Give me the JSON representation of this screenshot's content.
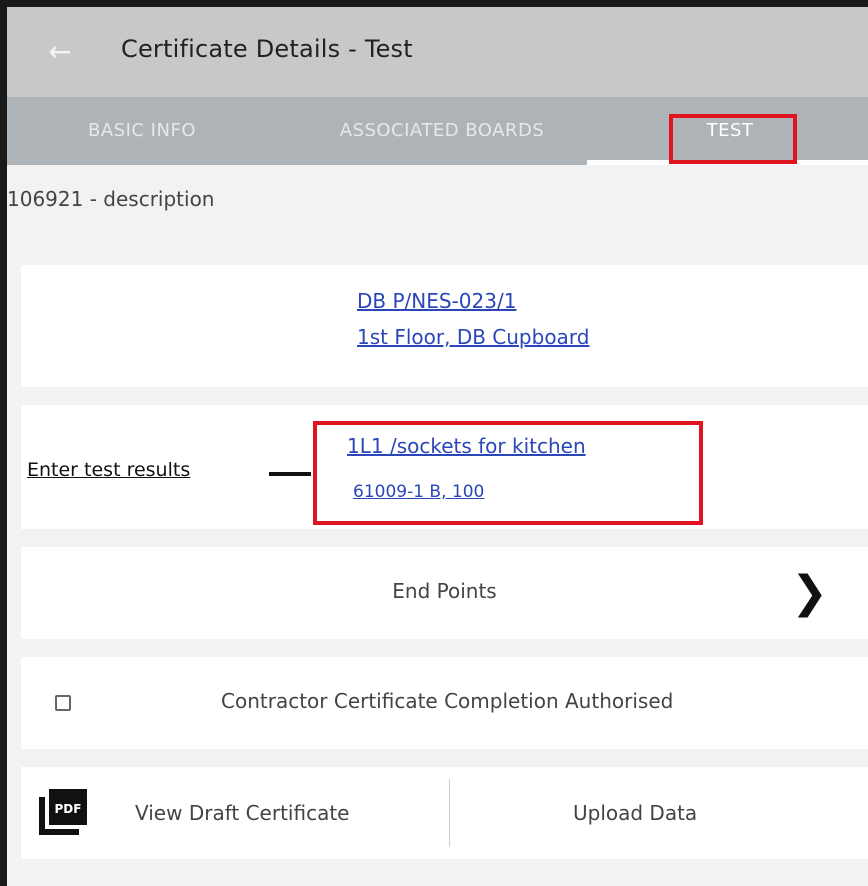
{
  "appbar": {
    "title": "Certificate Details - Test",
    "back_icon": "arrow-left-icon"
  },
  "tabs": [
    {
      "label": "BASIC INFO",
      "selected": false
    },
    {
      "label": "ASSOCIATED BOARDS",
      "selected": false
    },
    {
      "label": "TEST",
      "selected": true
    }
  ],
  "subheader": "106921 - description",
  "board": {
    "reference": "DB P/NES-023/1",
    "location": "1st Floor, DB Cupboard"
  },
  "circuit": {
    "annotation_label": "Enter test results",
    "line1": "1L1 /sockets for kitchen",
    "line2": "61009-1 B, 100"
  },
  "end_points": {
    "label": "End Points",
    "icon": "chevron-right-icon"
  },
  "contractor": {
    "label": "Contractor Certificate Completion Authorised",
    "checked": false
  },
  "actions": {
    "pdf_icon_text": "PDF",
    "view_draft": "View Draft Certificate",
    "upload": "Upload Data"
  },
  "colors": {
    "highlight": "#e0141e",
    "link": "#2a46b8",
    "appbar": "#c8c8c8",
    "tabbar": "#aeb3b8"
  }
}
